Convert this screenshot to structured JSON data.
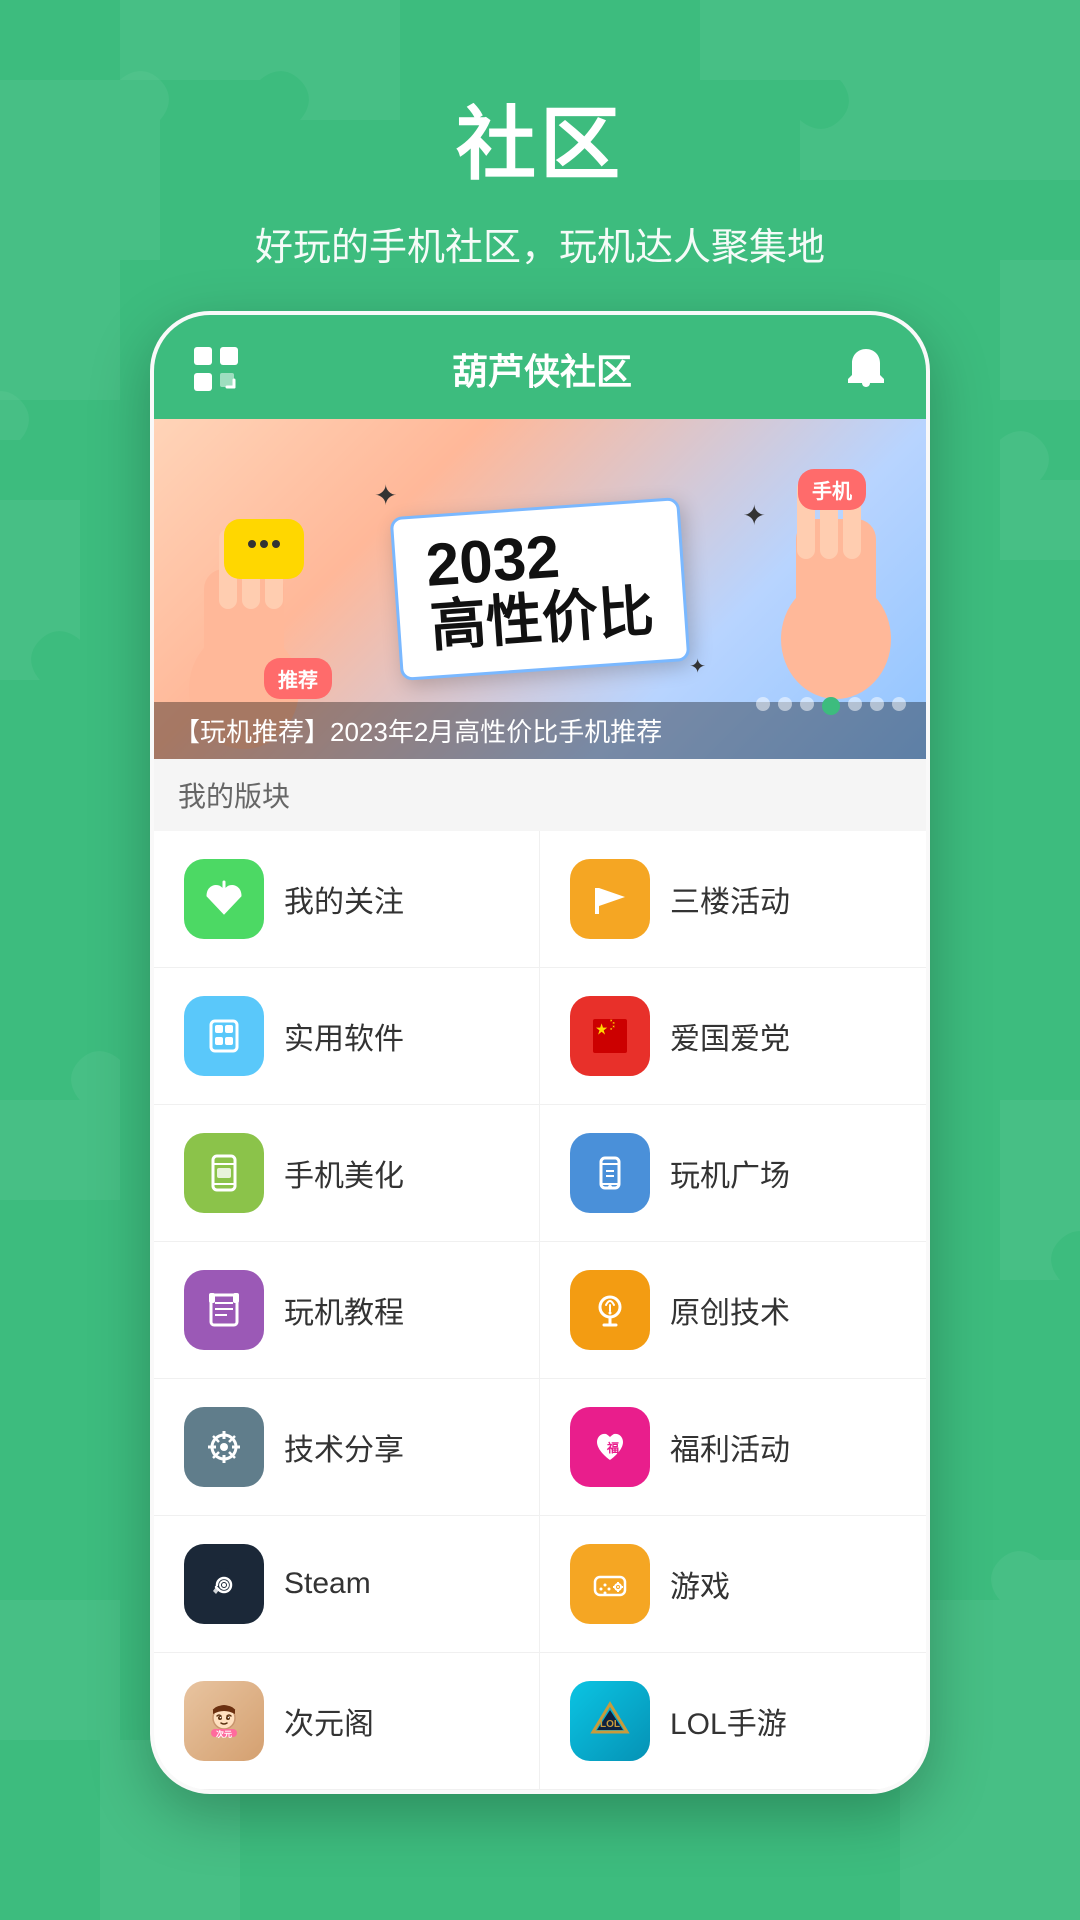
{
  "background": {
    "color": "#3dbc7e"
  },
  "header": {
    "title": "社区",
    "subtitle": "好玩的手机社区，玩机达人聚集地"
  },
  "app": {
    "header_title": "葫芦侠社区",
    "banner": {
      "year": "2032",
      "main_text": "高性价比",
      "badge_tuijian": "推荐",
      "badge_shouji": "手机",
      "caption": "【玩机推荐】2023年2月高性价比手机推荐",
      "dots": [
        false,
        false,
        false,
        true,
        false,
        false,
        false
      ]
    },
    "my_blocks_label": "我的版块",
    "menu_items": [
      {
        "id": "follow",
        "icon": "⭐",
        "icon_color": "icon-green",
        "label": "我的关注"
      },
      {
        "id": "activity",
        "icon": "🚩",
        "icon_color": "icon-yellow",
        "label": "三楼活动"
      },
      {
        "id": "software",
        "icon": "📦",
        "icon_color": "icon-cyan",
        "label": "实用软件"
      },
      {
        "id": "patriot",
        "icon": "🇨🇳",
        "icon_color": "icon-red",
        "label": "爱国爱党"
      },
      {
        "id": "beauty",
        "icon": "📗",
        "icon_color": "icon-lime",
        "label": "手机美化"
      },
      {
        "id": "plaza",
        "icon": "📱",
        "icon_color": "icon-blue",
        "label": "玩机广场"
      },
      {
        "id": "tutorial",
        "icon": "📖",
        "icon_color": "icon-purple",
        "label": "玩机教程"
      },
      {
        "id": "original",
        "icon": "💡",
        "icon_color": "icon-orange",
        "label": "原创技术"
      },
      {
        "id": "tech",
        "icon": "🔧",
        "icon_color": "icon-grey-blue",
        "label": "技术分享"
      },
      {
        "id": "welfare",
        "icon": "🎁",
        "icon_color": "icon-pink",
        "label": "福利活动"
      },
      {
        "id": "steam",
        "icon": "steam",
        "icon_color": "icon-steam",
        "label": "Steam"
      },
      {
        "id": "games",
        "icon": "🎮",
        "icon_color": "icon-gold",
        "label": "游戏"
      },
      {
        "id": "anime",
        "icon": "🎌",
        "icon_color": "icon-manga",
        "label": "次元阁"
      },
      {
        "id": "lol",
        "icon": "lol",
        "icon_color": "icon-lol",
        "label": "LOL手游"
      }
    ]
  }
}
